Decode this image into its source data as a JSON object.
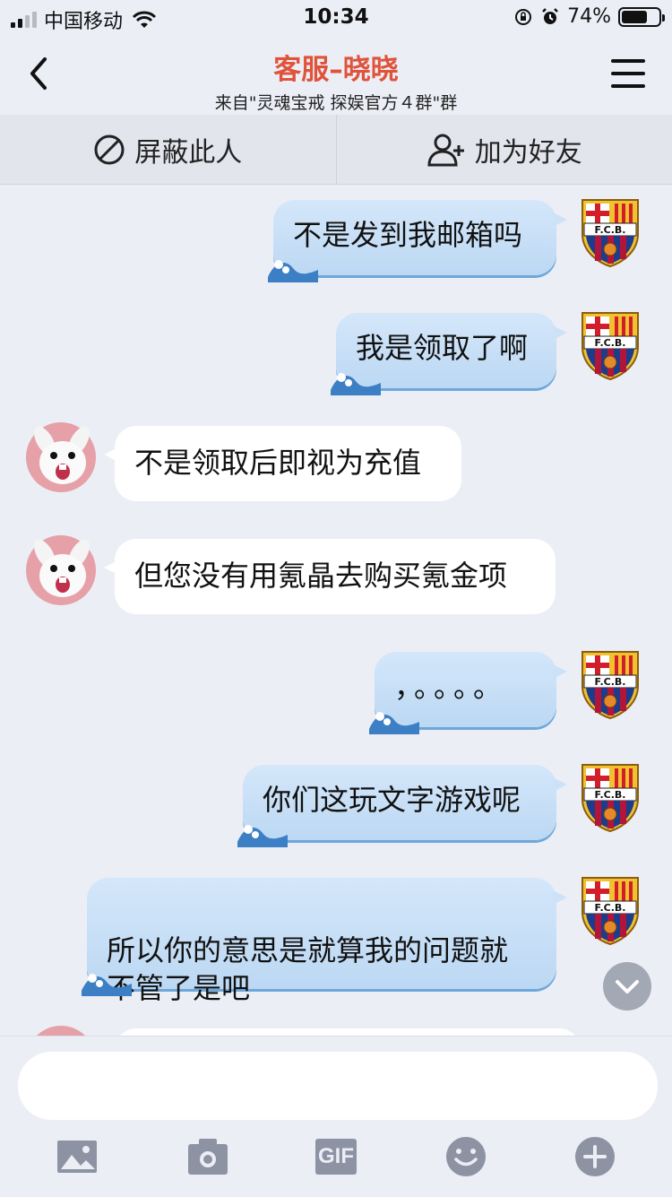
{
  "status_bar": {
    "carrier": "中国移动",
    "time": "10:34",
    "battery": "74%",
    "battery_level": 0.74
  },
  "header": {
    "title": "客服–晓晓",
    "subtitle": "来自\"灵魂宝戒 探娱官方４群\"群"
  },
  "actions": {
    "block_label": "屏蔽此人",
    "add_friend_label": "加为好友"
  },
  "messages": [
    {
      "side": "out",
      "text": "不是发到我邮箱吗"
    },
    {
      "side": "out",
      "text": "我是领取了啊"
    },
    {
      "side": "in",
      "text": "不是领取后即视为充值"
    },
    {
      "side": "in",
      "text": "但您没有用氪晶去购买氪金项"
    },
    {
      "side": "out",
      "text": "，。。。。"
    },
    {
      "side": "out",
      "text": "你们这玩文字游戏呢"
    },
    {
      "side": "out",
      "text": "所以你的意思是就算我的问题就\n不管了是吧"
    }
  ],
  "toolbar": {
    "icons": [
      "image-icon",
      "camera-icon",
      "gif-icon",
      "emoji-icon",
      "plus-icon"
    ],
    "gif_label": "GIF"
  },
  "colors": {
    "title": "#e0533b",
    "outgoing_bubble": "#c8e0f7",
    "incoming_bubble": "#ffffff",
    "background": "#eceef6"
  }
}
